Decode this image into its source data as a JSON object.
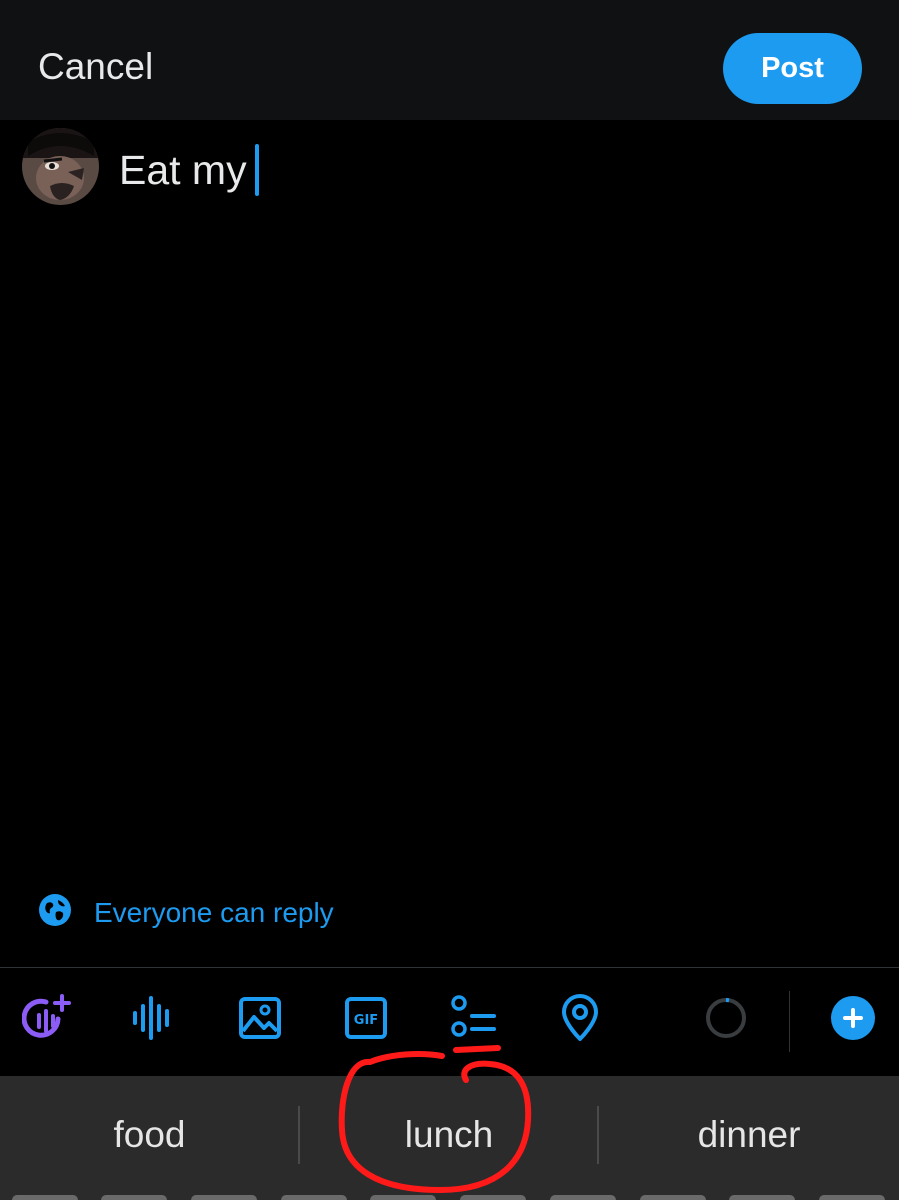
{
  "header": {
    "cancel_label": "Cancel",
    "post_label": "Post"
  },
  "composer": {
    "text": "Eat my",
    "avatar": "user-avatar"
  },
  "reply_setting": {
    "icon": "globe-icon",
    "label": "Everyone can reply"
  },
  "toolbar": {
    "items": [
      {
        "icon": "grok-voice-icon"
      },
      {
        "icon": "audio-waveform-icon"
      },
      {
        "icon": "image-icon"
      },
      {
        "icon": "gif-icon",
        "label": "GIF"
      },
      {
        "icon": "poll-icon"
      },
      {
        "icon": "location-pin-icon"
      }
    ],
    "progress_icon": "character-count-ring-icon",
    "add_icon": "plus-icon"
  },
  "suggestions": [
    "food",
    "lunch",
    "dinner"
  ],
  "colors": {
    "accent": "#1d9bf0",
    "background": "#000000",
    "header_bg": "#101112",
    "suggest_bg": "#2b2b2b",
    "annotation": "#ff1a1a",
    "grok_purple": "#8b5cf6"
  }
}
